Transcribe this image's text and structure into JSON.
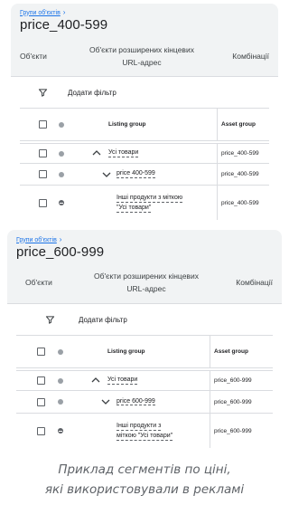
{
  "groups": [
    {
      "breadcrumb": "Групи об'єктів",
      "title": "price_400-599",
      "headers": {
        "objects": "Об'єкти",
        "url_line1": "Об'єкти розширених кінцевих",
        "url_line2": "URL-адрес",
        "combos": "Комбінації"
      },
      "add_filter": "Додати фільтр",
      "table": {
        "col_listing": "Listing group",
        "col_asset": "Asset group",
        "rows": [
          {
            "label": "Усі товари",
            "asset": "price_400-599"
          },
          {
            "label": "price 400-599",
            "asset": "price_400-599"
          },
          {
            "label_line1": "Інші продукти з міткою",
            "label_line2": "\"Усі товари\"",
            "asset": "price_400-599"
          }
        ]
      }
    },
    {
      "breadcrumb": "Групи об'єктів",
      "title": "price_600-999",
      "headers": {
        "objects": "Об'єкти",
        "url_line1": "Об'єкти розширених кінцевих",
        "url_line2": "URL-адрес",
        "combos": "Комбінації"
      },
      "add_filter": "Додати фільтр",
      "table": {
        "col_listing": "Listing group",
        "col_asset": "Asset group",
        "rows": [
          {
            "label": "Усі товари",
            "asset": "price_600-999"
          },
          {
            "label": "price 600-999",
            "asset": "price_600-999"
          },
          {
            "label_line1": "Інші продукти з",
            "label_line2": "міткою \"Усі товари\"",
            "asset": "price_600-999"
          }
        ]
      }
    }
  ],
  "caption": {
    "line1": "Приклад сегментів по ціні,",
    "line2": "які використовували в рекламі"
  },
  "colors": {
    "link": "#1a73e8",
    "card_bg": "#f1f3f4",
    "divider": "#dadce0"
  },
  "icons": [
    "chevron-right-icon",
    "filter-icon",
    "checkbox-icon",
    "status-dot-icon",
    "chevron-up-icon",
    "chevron-down-icon",
    "excluded-icon"
  ]
}
